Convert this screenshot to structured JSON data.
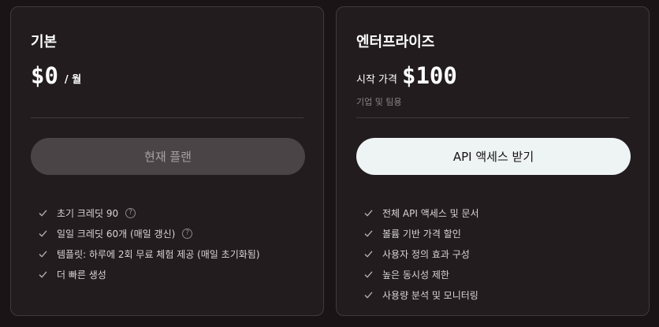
{
  "basic": {
    "title": "기본",
    "price": "$0",
    "unit": "/ 월",
    "button_label": "현재 플랜",
    "features": [
      {
        "label": "초기 크레딧 90",
        "help": true
      },
      {
        "label": "일일 크레딧 60개 (매일 갱신)",
        "help": true
      },
      {
        "label": "템플릿: 하루에 2회 무료 체험 제공 (매일 초기화됨)",
        "help": false
      },
      {
        "label": "더 빠른 생성",
        "help": false
      }
    ]
  },
  "enterprise": {
    "title": "엔터프라이즈",
    "price_prefix": "시작 가격",
    "price": "$100",
    "subtitle": "기업 및 팀용",
    "button_label": "API 액세스 받기",
    "features": [
      {
        "label": "전체 API 액세스 및 문서"
      },
      {
        "label": "볼륨 기반 가격 할인"
      },
      {
        "label": "사용자 정의 효과 구성"
      },
      {
        "label": "높은 동시성 제한"
      },
      {
        "label": "사용량 분석 및 모니터링"
      }
    ]
  },
  "icons": {
    "check": "check-icon",
    "help": "help-circle-icon",
    "help_glyph": "?"
  },
  "colors": {
    "background": "#1a1416",
    "card": "#221c1f",
    "current_button": "#4a4447",
    "primary_button": "#eef3f4"
  }
}
